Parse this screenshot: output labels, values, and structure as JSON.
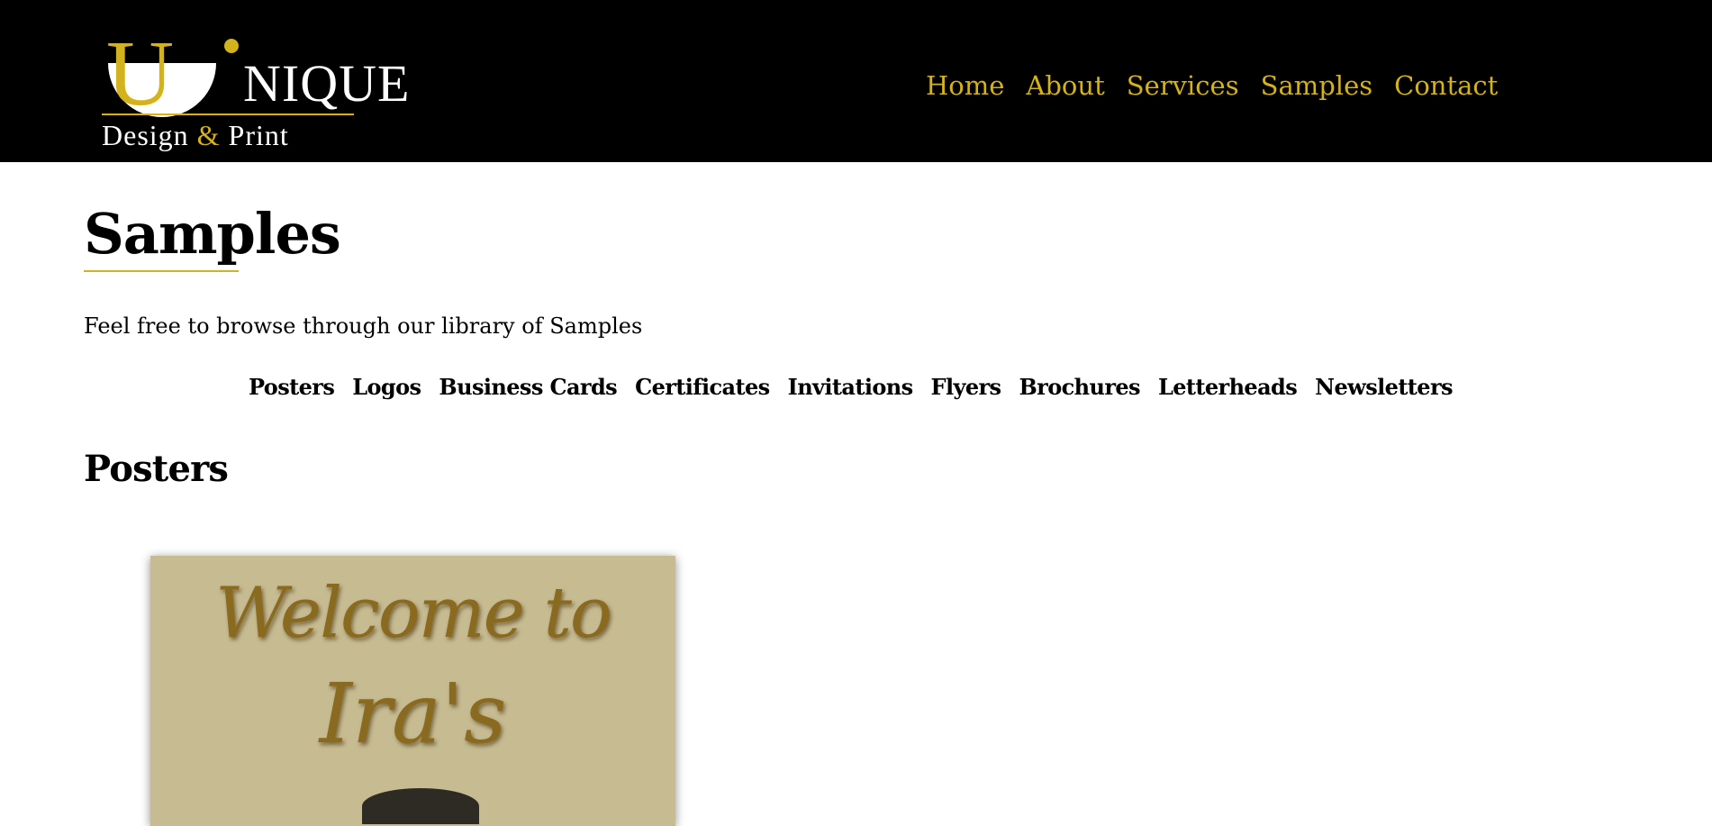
{
  "header": {
    "logo": {
      "wordmark": "NIQUE",
      "initial": "U",
      "tagline_part1": "Design ",
      "tagline_amp": "&",
      "tagline_part2": " Print",
      "accent_color": "#d4b21b"
    },
    "nav": [
      {
        "label": "Home"
      },
      {
        "label": "About"
      },
      {
        "label": "Services"
      },
      {
        "label": "Samples"
      },
      {
        "label": "Contact"
      }
    ]
  },
  "main": {
    "title": "Samples",
    "intro": "Feel free to browse through our library of Samples",
    "categories": [
      {
        "label": "Posters"
      },
      {
        "label": "Logos"
      },
      {
        "label": "Business Cards"
      },
      {
        "label": "Certificates"
      },
      {
        "label": "Invitations"
      },
      {
        "label": "Flyers"
      },
      {
        "label": "Brochures"
      },
      {
        "label": "Letterheads"
      },
      {
        "label": "Newsletters"
      }
    ],
    "section_title": "Posters",
    "poster": {
      "line1": "Welcome to",
      "line2": "Ira's",
      "background_color": "#c7bb92",
      "text_color": "#8a6a1f"
    }
  },
  "colors": {
    "header_bg": "#000000",
    "accent": "#d4b21b",
    "page_bg": "#ffffff"
  }
}
